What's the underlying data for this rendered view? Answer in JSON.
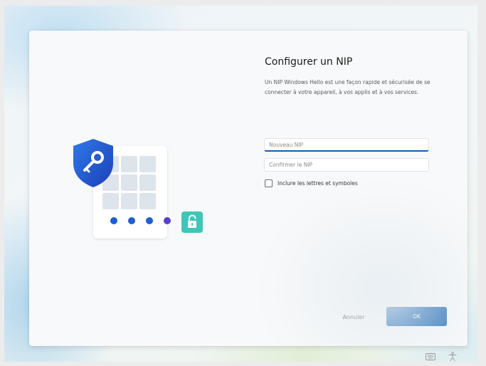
{
  "dialog": {
    "title": "Configurer un NIP",
    "description": "Un NIP Windows Hello est une façon rapide et sécurisée de se connecter à votre appareil, à vos applis et à vos services."
  },
  "form": {
    "new_pin_placeholder": "Nouveau NIP",
    "confirm_pin_placeholder": "Confirmer le NIP",
    "include_letters_label": "Inclure les lettres et symboles",
    "include_letters_checked": false
  },
  "buttons": {
    "cancel_label": "Annuler",
    "ok_label": "OK"
  },
  "illustration": {
    "shield_icon": "shield-key-icon",
    "unlock_icon": "unlock-icon",
    "pin_dot_count": 4,
    "keypad_cells": 9
  },
  "tray": {
    "keyboard_icon": "keyboard-icon",
    "accessibility_icon": "accessibility-icon"
  },
  "colors": {
    "accent": "#0f5fb0",
    "shield_blue": "#1f5cd6",
    "unlock_teal": "#3fc6b6",
    "pin_dot": "#1e5fd2"
  }
}
